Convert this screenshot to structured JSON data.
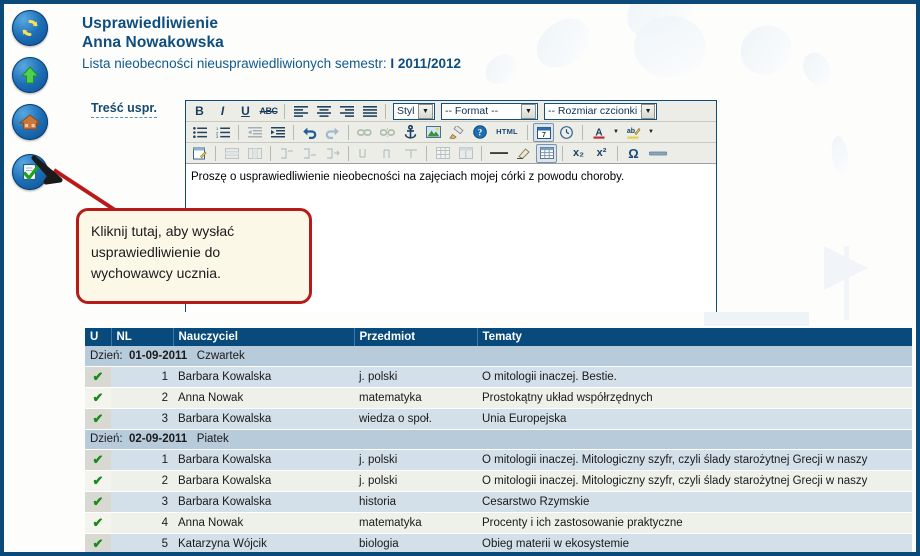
{
  "header": {
    "title_line1": "Usprawiedliwienie",
    "title_line2": "Anna Nowakowska",
    "subtitle_prefix": "Lista nieobecności nieusprawiedliwionych semestr: ",
    "subtitle_value": "I 2011/2012"
  },
  "sidebar": {
    "items": [
      {
        "name": "refresh-icon",
        "label": "Odśwież"
      },
      {
        "name": "up-arrow-icon",
        "label": "Do góry"
      },
      {
        "name": "home-icon",
        "label": "Strona główna"
      }
    ],
    "send_button": {
      "name": "send-justification-icon",
      "label": "Wyślij usprawiedliwienie"
    }
  },
  "form": {
    "field_label": "Treść uspr."
  },
  "editor": {
    "toolbar_row1": [
      {
        "name": "bold-button",
        "glyph": "B",
        "label": "Pogrubienie"
      },
      {
        "name": "italic-button",
        "glyph": "I",
        "label": "Kursywa"
      },
      {
        "name": "underline-button",
        "glyph": "U",
        "label": "Podkreślenie"
      },
      {
        "name": "strikethrough-button",
        "glyph": "ABC",
        "label": "Przekreślenie"
      },
      {
        "name": "align-left-button",
        "glyph": "≡",
        "label": "Wyrównaj do lewej"
      },
      {
        "name": "align-center-button",
        "glyph": "≡",
        "label": "Wyśrodkuj"
      },
      {
        "name": "align-right-button",
        "glyph": "≡",
        "label": "Wyrównaj do prawej"
      },
      {
        "name": "align-justify-button",
        "glyph": "≡",
        "label": "Wyjustuj"
      }
    ],
    "dropdowns": [
      {
        "name": "style-select",
        "value": "Styl"
      },
      {
        "name": "format-select",
        "value": "-- Format --"
      },
      {
        "name": "font-size-select",
        "value": "-- Rozmiar czcionki --"
      }
    ],
    "toolbar_row2": [
      {
        "name": "bulleted-list-button",
        "label": "Lista punktowana"
      },
      {
        "name": "numbered-list-button",
        "label": "Lista numerowana"
      },
      {
        "name": "decrease-indent-button",
        "label": "Zmniejsz wcięcie"
      },
      {
        "name": "increase-indent-button",
        "label": "Zwiększ wcięcie"
      },
      {
        "name": "undo-button",
        "label": "Cofnij"
      },
      {
        "name": "redo-button",
        "label": "Ponów"
      },
      {
        "name": "insert-link-button",
        "label": "Wstaw odnośnik"
      },
      {
        "name": "unlink-button",
        "label": "Usuń odnośnik"
      },
      {
        "name": "anchor-button",
        "label": "Kotwica"
      },
      {
        "name": "insert-image-button",
        "label": "Wstaw obrazek"
      },
      {
        "name": "remove-format-button",
        "label": "Usuń formatowanie"
      },
      {
        "name": "about-button",
        "label": "O programie"
      },
      {
        "name": "source-html-button",
        "glyph": "HTML",
        "label": "Źródło HTML"
      },
      {
        "name": "insert-date-button",
        "label": "Wstaw datę"
      },
      {
        "name": "insert-time-button",
        "label": "Wstaw czas"
      },
      {
        "name": "text-color-button",
        "glyph": "A",
        "label": "Kolor tekstu"
      },
      {
        "name": "background-color-button",
        "glyph": "ab",
        "label": "Kolor tła"
      }
    ],
    "toolbar_row3": [
      {
        "name": "edit-form-button",
        "label": "Formularz"
      },
      {
        "name": "insert-row-button",
        "label": "Wstaw wiersz"
      },
      {
        "name": "insert-column-button",
        "label": "Wstaw kolumnę"
      },
      {
        "name": "merge-cells-button",
        "label": "Scal komórki"
      },
      {
        "name": "split-cell-button",
        "label": "Podziel komórkę"
      },
      {
        "name": "cell-properties-button",
        "label": "Właściwości komórki"
      },
      {
        "name": "row-tools-button",
        "label": "Narzędzia wiersza"
      },
      {
        "name": "column-tools-button",
        "label": "Narzędzia kolumny"
      },
      {
        "name": "table-delete-button",
        "label": "Usuń tabelę"
      },
      {
        "name": "insert-table-button",
        "label": "Wstaw tabelę"
      },
      {
        "name": "table-properties-button",
        "label": "Właściwości tabeli"
      },
      {
        "name": "horizontal-rule-button",
        "glyph": "—",
        "label": "Linia pozioma"
      },
      {
        "name": "erase-button",
        "label": "Wymaż"
      },
      {
        "name": "show-grid-button",
        "label": "Pokaż siatkę"
      },
      {
        "name": "subscript-button",
        "glyph": "x₂",
        "label": "Indeks dolny"
      },
      {
        "name": "superscript-button",
        "glyph": "x²",
        "label": "Indeks górny"
      },
      {
        "name": "special-char-button",
        "glyph": "Ω",
        "label": "Znak specjalny"
      },
      {
        "name": "page-break-button",
        "label": "Podział strony"
      }
    ],
    "content": "Proszę o usprawiedliwienie nieobecności na zajęciach mojej córki z powodu choroby."
  },
  "callout": {
    "text": "Kliknij tutaj, aby wysłać usprawiedliwienie do wychowawcy ucznia.",
    "border_color": "#b81a1a",
    "background_color": "#fbf8e8"
  },
  "table": {
    "columns": [
      "U",
      "NL",
      "Nauczyciel",
      "Przedmiot",
      "Tematy"
    ],
    "day_label": "Dzień:",
    "groups": [
      {
        "date": "01-09-2011",
        "weekday": "Czwartek",
        "rows": [
          {
            "u": "✔",
            "nl": "1",
            "teacher": "Barbara Kowalska",
            "subject": "j. polski",
            "topic": "O mitologii inaczej. Bestie."
          },
          {
            "u": "✔",
            "nl": "2",
            "teacher": "Anna Nowak",
            "subject": "matematyka",
            "topic": "Prostokątny układ współrzędnych"
          },
          {
            "u": "✔",
            "nl": "3",
            "teacher": "Barbara Kowalska",
            "subject": "wiedza o społ.",
            "topic": "Unia Europejska"
          }
        ]
      },
      {
        "date": "02-09-2011",
        "weekday": "Piatek",
        "rows": [
          {
            "u": "✔",
            "nl": "1",
            "teacher": "Barbara Kowalska",
            "subject": "j. polski",
            "topic": "O mitologii inaczej. Mitologiczny szyfr, czyli ślady starożytnej Grecji w naszy"
          },
          {
            "u": "✔",
            "nl": "2",
            "teacher": "Barbara Kowalska",
            "subject": "j. polski",
            "topic": "O mitologii inaczej. Mitologiczny szyfr, czyli ślady starożytnej Grecji w naszy"
          },
          {
            "u": "✔",
            "nl": "3",
            "teacher": "Barbara Kowalska",
            "subject": "historia",
            "topic": "Cesarstwo Rzymskie"
          },
          {
            "u": "✔",
            "nl": "4",
            "teacher": "Anna Nowak",
            "subject": "matematyka",
            "topic": "Procenty i ich zastosowanie praktyczne"
          },
          {
            "u": "✔",
            "nl": "5",
            "teacher": "Katarzyna Wójcik",
            "subject": "biologia",
            "topic": "Obieg materii w ekosystemie"
          }
        ]
      }
    ]
  },
  "colors": {
    "frame": "#0b4a78",
    "header_text": "#0d4d7f",
    "table_header_bg": "#084a7b",
    "day_row_bg": "#b8cbdb",
    "row_odd": "#d3dfe9",
    "row_even": "#eef0ea",
    "check_green": "#1a8a1a"
  }
}
